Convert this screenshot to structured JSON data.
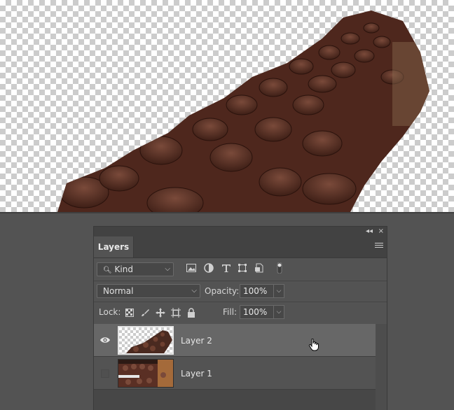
{
  "panel": {
    "title_controls": {
      "collapse": "◂◂",
      "close": "×"
    },
    "tab_label": "Layers",
    "menu_icon": "hamburger-menu-icon"
  },
  "filter": {
    "kind_label": "Kind",
    "icons": [
      "image-filter-icon",
      "adjustment-filter-icon",
      "type-filter-icon",
      "shape-filter-icon",
      "smart-object-filter-icon",
      "filter-toggle-icon"
    ]
  },
  "blend": {
    "mode": "Normal",
    "opacity_label": "Opacity:",
    "opacity_value": "100%"
  },
  "lock": {
    "label": "Lock:",
    "icons": [
      "lock-transparent-pixels-icon",
      "lock-image-pixels-icon",
      "lock-position-icon",
      "lock-artboard-icon",
      "lock-all-icon"
    ],
    "fill_label": "Fill:",
    "fill_value": "100%"
  },
  "layers": [
    {
      "name": "Layer 2",
      "visible": true,
      "selected": true
    },
    {
      "name": "Layer 1",
      "visible": false,
      "selected": false
    }
  ],
  "colors": {
    "panel_bg": "#535353",
    "selected_row": "#676767",
    "bottle_brown": "#4a2a20"
  }
}
